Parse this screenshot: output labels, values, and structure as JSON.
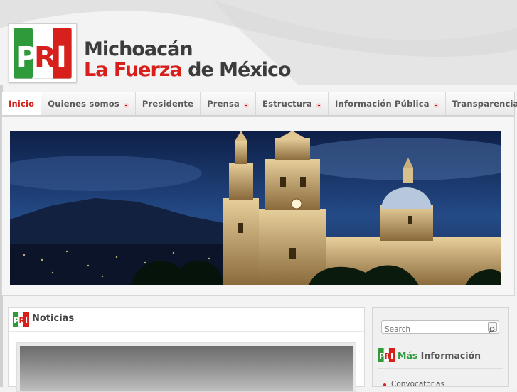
{
  "header": {
    "logo_text": "PRI",
    "title_line1": "Michoacán",
    "title_line2_a": "La Fuerza",
    "title_line2_b": " de México"
  },
  "nav": {
    "items": [
      {
        "label": "Inicio",
        "active": true,
        "dropdown": false
      },
      {
        "label": "Quienes somos",
        "active": false,
        "dropdown": true
      },
      {
        "label": "Presidente",
        "active": false,
        "dropdown": false
      },
      {
        "label": "Prensa",
        "active": false,
        "dropdown": true
      },
      {
        "label": "Estructura",
        "active": false,
        "dropdown": true
      },
      {
        "label": "Información Pública",
        "active": false,
        "dropdown": true
      },
      {
        "label": "Transparencia",
        "active": false,
        "dropdown": false
      }
    ]
  },
  "main": {
    "section_title": "Noticias"
  },
  "sidebar": {
    "search_placeholder": "Search",
    "section_title_a": "Más",
    "section_title_b": " Información",
    "links": [
      "Convocatorias"
    ]
  },
  "colors": {
    "brand_red": "#d7201c",
    "brand_green": "#2e9a3c",
    "nav_text": "#5a5a5a"
  }
}
